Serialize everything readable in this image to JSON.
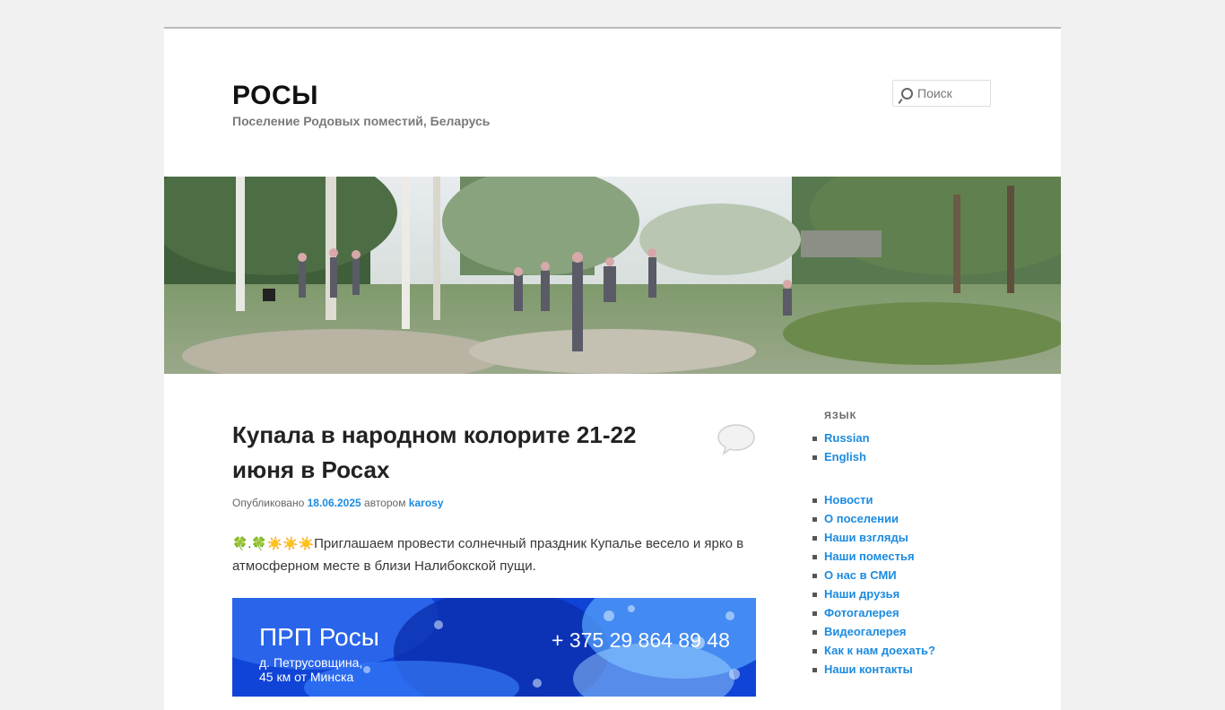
{
  "header": {
    "site_title": "РОСЫ",
    "site_description": "Поселение Родовых поместий, Беларусь",
    "search_placeholder": "Поиск"
  },
  "post": {
    "title": "Купала в народном колорите 21-22 июня в Росах",
    "meta_published": "Опубликовано",
    "meta_date": "18.06.2025",
    "meta_by": "автором",
    "meta_author": "karosy",
    "text_emojis": "🍀.🍀☀️☀️☀️",
    "text": "Приглашаем провести солнечный праздник Купалье весело и ярко в атмосферном месте в близи Налибокской пущи.",
    "image": {
      "title": "ПРП Росы",
      "phone": "+ 375 29 864 89 48",
      "address_line1": "д. Петрусовщина,",
      "address_line2": "45 км от Минска"
    }
  },
  "sidebar": {
    "language_heading": "ЯЗЫК",
    "languages": [
      "Russian",
      "English"
    ],
    "nav": [
      "Новости",
      "О поселении",
      "Наши взгляды",
      "Наши поместья",
      "О нас в СМИ",
      "Наши друзья",
      "Фотогалерея",
      "Видеогалерея",
      "Как к нам доехать?",
      "Наши контакты"
    ]
  },
  "colors": {
    "background": "#f1f1f1",
    "page": "#ffffff",
    "link": "#1b8be0",
    "title": "#111111"
  },
  "icons": {
    "search": "search-icon",
    "comments": "comment-bubble-icon"
  }
}
